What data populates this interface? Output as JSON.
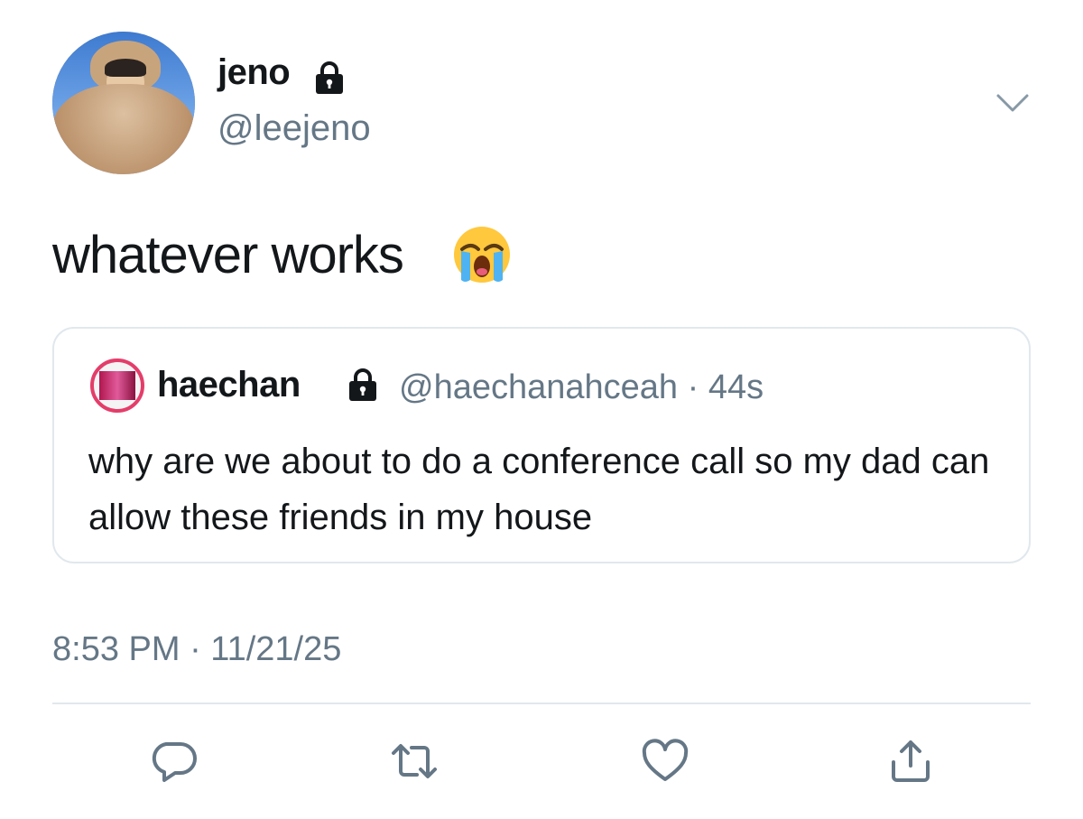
{
  "tweet": {
    "author": {
      "display_name": "jeno",
      "handle": "@leejeno",
      "protected_icon": "lock-icon"
    },
    "text": "whatever works",
    "emoji": "loudly-crying-face",
    "timestamp": "8:53 PM · 11/21/25"
  },
  "quoted_tweet": {
    "display_name": "haechan",
    "protected_icon": "lock-icon",
    "meta": "@haechanahceah · 44s",
    "text": "why are we about to do a conference call so my dad can allow these friends in my house"
  },
  "actions": {
    "reply_icon": "reply-icon",
    "retweet_icon": "retweet-icon",
    "like_icon": "heart-icon",
    "share_icon": "share-icon"
  },
  "colors": {
    "text": "#14171a",
    "secondary": "#657786",
    "border": "#e1e8ed"
  }
}
